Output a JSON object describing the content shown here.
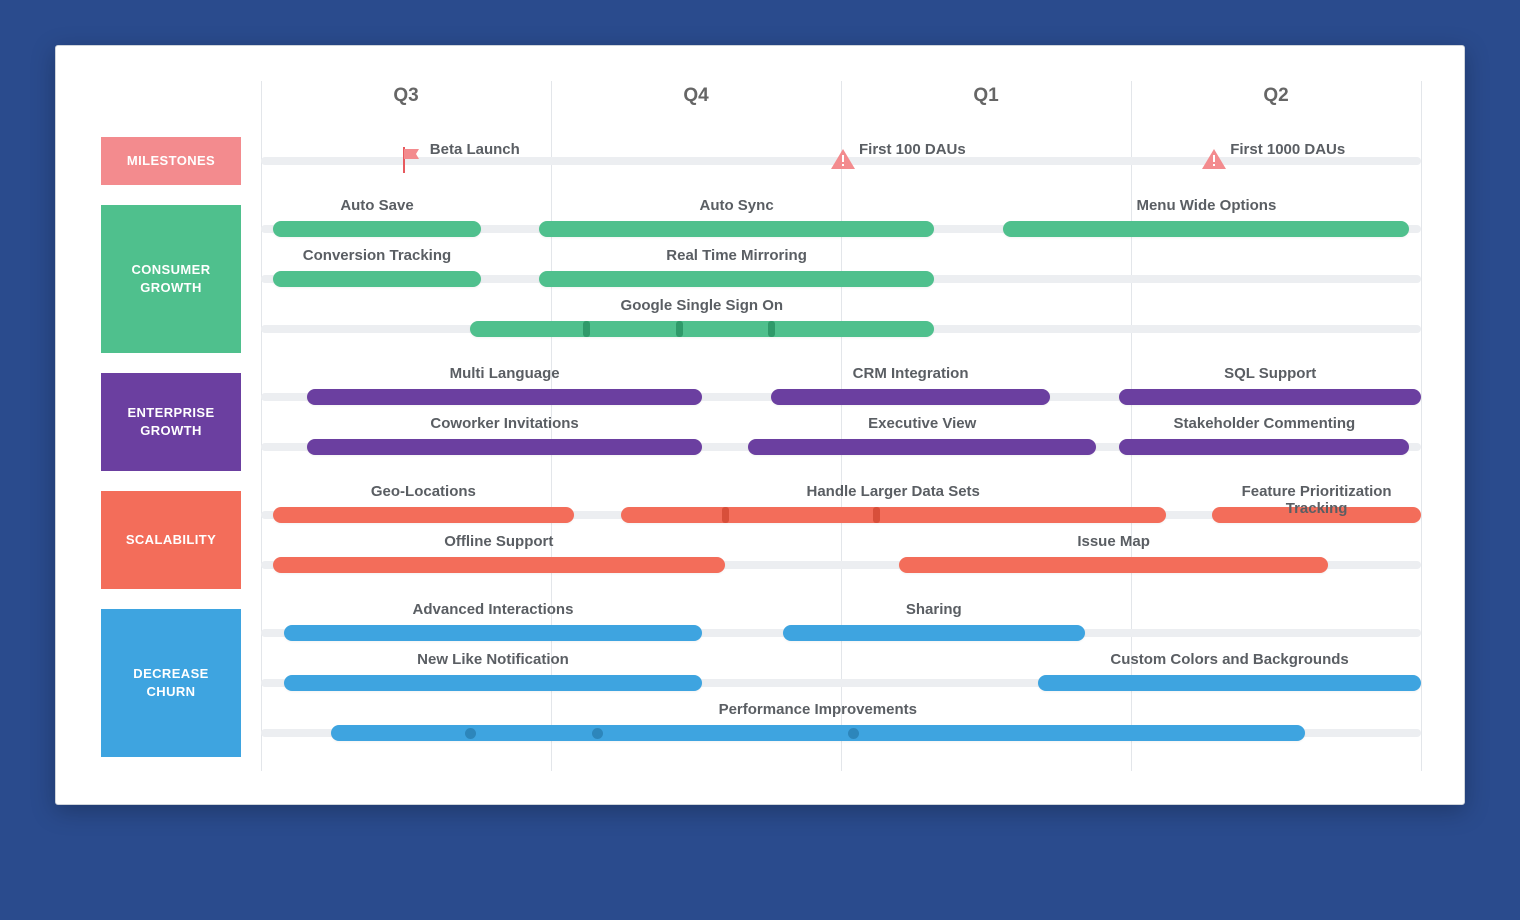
{
  "colors": {
    "pink": "#f38b8e",
    "pinkDk": "#e7595e",
    "green": "#4fc08d",
    "greenDk": "#2f9a6a",
    "purple": "#6b3fa0",
    "orange": "#f36d5a",
    "orangeDk": "#d84f3a",
    "blue": "#3ea4e0",
    "blueDk": "#2d86bb",
    "track": "#eceef1"
  },
  "header": {
    "quarters": [
      "Q3",
      "Q4",
      "Q1",
      "Q2"
    ]
  },
  "categories": [
    {
      "id": "milestones",
      "label": "MILESTONES",
      "color": "pink"
    },
    {
      "id": "consumer",
      "label": "CONSUMER GROWTH",
      "color": "green"
    },
    {
      "id": "enterprise",
      "label": "ENTERPRISE GROWTH",
      "color": "purple"
    },
    {
      "id": "scale",
      "label": "SCALABILITY",
      "color": "orange"
    },
    {
      "id": "churn",
      "label": "DECREASE CHURN",
      "color": "blue"
    }
  ],
  "milestones": [
    {
      "label": "Beta Launch",
      "icon": "flag",
      "x": 0.13
    },
    {
      "label": "First 100 DAUs",
      "icon": "alert",
      "x": 0.5
    },
    {
      "label": "First 1000 DAUs",
      "icon": "alert",
      "x": 0.82
    }
  ],
  "chart_data": {
    "type": "bar",
    "xlabel": "",
    "ylabel": "",
    "title": "",
    "x_domain": [
      "Q3",
      "Q4",
      "Q1",
      "Q2"
    ],
    "series": [
      {
        "cat": "consumer",
        "row": 0,
        "label": "Auto Save",
        "start": 0.01,
        "end": 0.19
      },
      {
        "cat": "consumer",
        "row": 0,
        "label": "Auto Sync",
        "start": 0.24,
        "end": 0.58
      },
      {
        "cat": "consumer",
        "row": 0,
        "label": "Menu Wide Options",
        "start": 0.64,
        "end": 0.99
      },
      {
        "cat": "consumer",
        "row": 1,
        "label": "Conversion Tracking",
        "start": 0.01,
        "end": 0.19
      },
      {
        "cat": "consumer",
        "row": 1,
        "label": "Real Time Mirroring",
        "start": 0.24,
        "end": 0.58
      },
      {
        "cat": "consumer",
        "row": 2,
        "label": "Google Single Sign On",
        "start": 0.18,
        "end": 0.58,
        "ticks": [
          0.28,
          0.36,
          0.44
        ]
      },
      {
        "cat": "enterprise",
        "row": 0,
        "label": "Multi Language",
        "start": 0.04,
        "end": 0.38
      },
      {
        "cat": "enterprise",
        "row": 0,
        "label": "CRM Integration",
        "start": 0.44,
        "end": 0.68
      },
      {
        "cat": "enterprise",
        "row": 0,
        "label": "SQL Support",
        "start": 0.74,
        "end": 1.0
      },
      {
        "cat": "enterprise",
        "row": 1,
        "label": "Coworker Invitations",
        "start": 0.04,
        "end": 0.38
      },
      {
        "cat": "enterprise",
        "row": 1,
        "label": "Executive View",
        "start": 0.42,
        "end": 0.72
      },
      {
        "cat": "enterprise",
        "row": 1,
        "label": "Stakeholder Commenting",
        "start": 0.74,
        "end": 0.99
      },
      {
        "cat": "scale",
        "row": 0,
        "label": "Geo-Locations",
        "start": 0.01,
        "end": 0.27
      },
      {
        "cat": "scale",
        "row": 0,
        "label": "Handle Larger Data Sets",
        "start": 0.31,
        "end": 0.78,
        "ticks": [
          0.4,
          0.53
        ]
      },
      {
        "cat": "scale",
        "row": 0,
        "label": "Feature Prioritization Tracking",
        "start": 0.82,
        "end": 1.0
      },
      {
        "cat": "scale",
        "row": 1,
        "label": "Offline Support",
        "start": 0.01,
        "end": 0.4
      },
      {
        "cat": "scale",
        "row": 1,
        "label": "Issue Map",
        "start": 0.55,
        "end": 0.92
      },
      {
        "cat": "churn",
        "row": 0,
        "label": "Advanced Interactions",
        "start": 0.02,
        "end": 0.38
      },
      {
        "cat": "churn",
        "row": 0,
        "label": "Sharing",
        "start": 0.45,
        "end": 0.71
      },
      {
        "cat": "churn",
        "row": 1,
        "label": "New Like Notification",
        "start": 0.02,
        "end": 0.38
      },
      {
        "cat": "churn",
        "row": 1,
        "label": "Custom Colors and Backgrounds",
        "start": 0.67,
        "end": 1.0
      },
      {
        "cat": "churn",
        "row": 2,
        "label": "Performance Improvements",
        "start": 0.06,
        "end": 0.9,
        "dots": [
          0.18,
          0.29,
          0.51
        ]
      }
    ]
  }
}
